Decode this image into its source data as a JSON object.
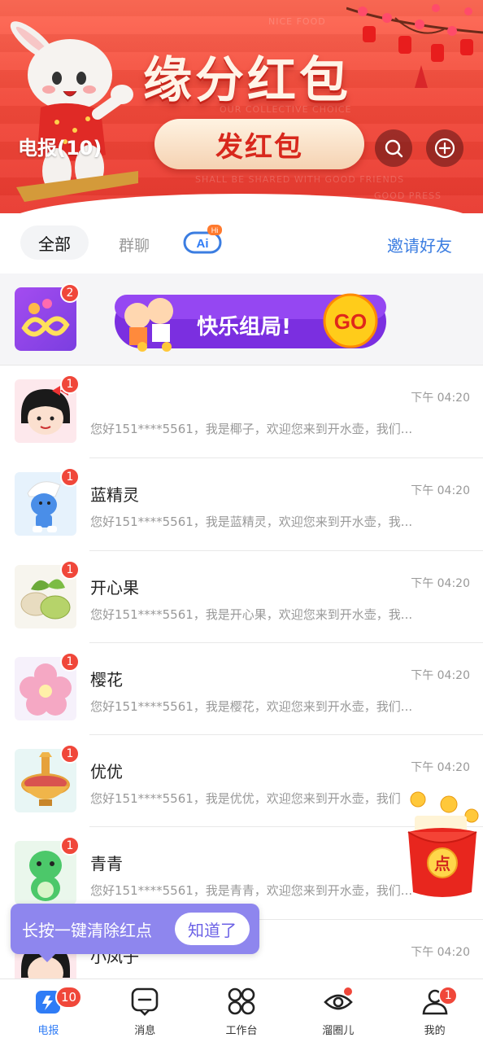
{
  "header": {
    "banner_title": "缘分红包",
    "banner_button": "发红包",
    "app_title": "电报(10)"
  },
  "tabs": {
    "all": "全部",
    "group": "群聊",
    "ai_label": "Ai",
    "ai_tag": "Hi",
    "invite": "邀请好友"
  },
  "promo": {
    "badge": "2",
    "banner_text": "快乐组局!",
    "banner_go": "GO"
  },
  "chats": [
    {
      "name": "",
      "time": "下午 04:20",
      "msg": "您好151****5561，我是椰子，欢迎您来到开水壶，我们...",
      "badge": "1"
    },
    {
      "name": "蓝精灵",
      "time": "下午 04:20",
      "msg": "您好151****5561，我是蓝精灵，欢迎您来到开水壶，我...",
      "badge": "1"
    },
    {
      "name": "开心果",
      "time": "下午 04:20",
      "msg": "您好151****5561，我是开心果，欢迎您来到开水壶，我...",
      "badge": "1"
    },
    {
      "name": "樱花",
      "time": "下午 04:20",
      "msg": "您好151****5561，我是樱花，欢迎您来到开水壶，我们...",
      "badge": "1"
    },
    {
      "name": "优优",
      "time": "下午 04:20",
      "msg": "您好151****5561，我是优优，欢迎您来到开水壶，我们",
      "badge": "1"
    },
    {
      "name": "青青",
      "time": "",
      "msg": "您好151****5561，我是青青，欢迎您来到开水壶，我们...",
      "badge": "1"
    },
    {
      "name": "小凤子",
      "time": "下午 04:20",
      "msg": "",
      "badge": ""
    }
  ],
  "toast": {
    "text": "长按一键清除红点",
    "button": "知道了"
  },
  "float_envelope": {
    "text": "点"
  },
  "nav": {
    "items": [
      {
        "label": "电报",
        "badge": "10"
      },
      {
        "label": "消息",
        "badge": ""
      },
      {
        "label": "工作台",
        "badge": ""
      },
      {
        "label": "溜圈儿",
        "badge": ""
      },
      {
        "label": "我的",
        "badge": "1"
      }
    ]
  },
  "colors": {
    "accent": "#2f7cf6",
    "badge": "#f0473a",
    "banner": "#f24a3b",
    "toast": "#8e86ee"
  },
  "icons": [
    "search-icon",
    "add-icon",
    "telegram-icon",
    "message-icon",
    "workbench-icon",
    "circle-eye-icon",
    "profile-icon"
  ]
}
